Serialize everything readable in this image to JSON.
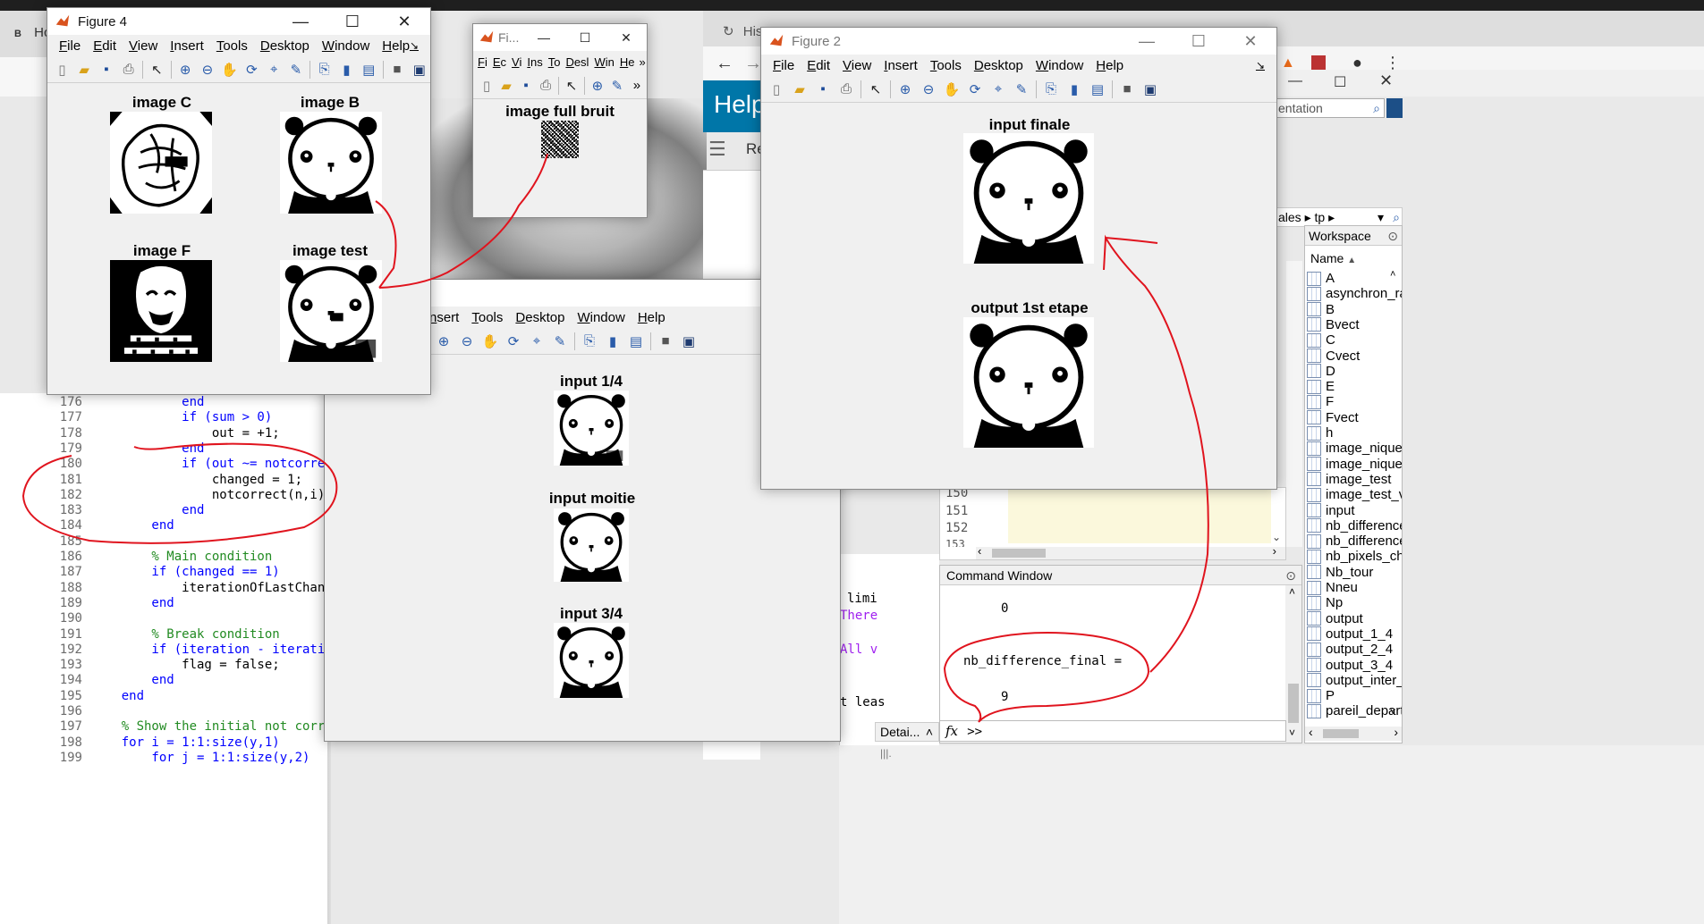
{
  "figure4": {
    "title": "Figure 4",
    "menu": [
      "File",
      "Edit",
      "View",
      "Insert",
      "Tools",
      "Desktop",
      "Window",
      "Help"
    ],
    "axes": [
      "image C",
      "image B",
      "image F",
      "image test"
    ]
  },
  "figure_small": {
    "title": "Fi...",
    "menu": [
      "Fi",
      "Ec",
      "Vi",
      "Ins",
      "To",
      "Desl",
      "Win",
      "He"
    ],
    "axes": [
      "image full bruit"
    ]
  },
  "figure_center": {
    "menu": [
      "nsert",
      "Tools",
      "Desktop",
      "Window",
      "Help"
    ],
    "axes": [
      "input 1/4",
      "input moitie",
      "input 3/4"
    ]
  },
  "figure2": {
    "title": "Figure 2",
    "menu": [
      "File",
      "Edit",
      "View",
      "Insert",
      "Tools",
      "Desktop",
      "Window",
      "Help"
    ],
    "axes": [
      "input finale",
      "output 1st etape"
    ]
  },
  "browser": {
    "tab_short": "Hc",
    "tab_hist": "Hist",
    "help_title": "Help",
    "help_search_frag": "Re",
    "doc_search_placeholder": "entation",
    "breadcrumb": [
      "ales",
      "tp"
    ]
  },
  "editor": {
    "lines": [
      {
        "n": "176",
        "text": "            end",
        "kind": "kw"
      },
      {
        "n": "177",
        "text": "            if (sum > 0)",
        "kind": "kw"
      },
      {
        "n": "178",
        "text": "                out = +1;",
        "kind": "tx"
      },
      {
        "n": "179",
        "text": "            end",
        "kind": "kw"
      },
      {
        "n": "180",
        "text": "            if (out ~= notcorrect(n, i))",
        "kind": "kw"
      },
      {
        "n": "181",
        "text": "                changed = 1;",
        "kind": "tx"
      },
      {
        "n": "182",
        "text": "                notcorrect(n,i) = out;",
        "kind": "tx"
      },
      {
        "n": "183",
        "text": "            end",
        "kind": "kw"
      },
      {
        "n": "184",
        "text": "        end",
        "kind": "kw"
      },
      {
        "n": "185",
        "text": "",
        "kind": "tx"
      },
      {
        "n": "186",
        "text": "        % Main condition",
        "kind": "cm"
      },
      {
        "n": "187",
        "text": "        if (changed == 1)",
        "kind": "kw"
      },
      {
        "n": "188",
        "text": "            iterationOfLastChange = iter",
        "kind": "tx"
      },
      {
        "n": "189",
        "text": "        end",
        "kind": "kw"
      },
      {
        "n": "190",
        "text": "",
        "kind": "tx"
      },
      {
        "n": "191",
        "text": "        % Break condition",
        "kind": "cm"
      },
      {
        "n": "192",
        "text": "        if (iteration - iterationOfLastC",
        "kind": "kw"
      },
      {
        "n": "193",
        "text": "            flag = false;",
        "kind": "tx"
      },
      {
        "n": "194",
        "text": "        end",
        "kind": "kw"
      },
      {
        "n": "195",
        "text": "    end",
        "kind": "kw"
      },
      {
        "n": "196",
        "text": "",
        "kind": "tx"
      },
      {
        "n": "197",
        "text": "    % Show the initial not correct input",
        "kind": "cm"
      },
      {
        "n": "198",
        "text": "    for i = 1:1:size(y,1)",
        "kind": "kw"
      },
      {
        "n": "199",
        "text": "        for j = 1:1:size(y,2)",
        "kind": "kw"
      }
    ],
    "right_lines": [
      "150",
      "151",
      "152",
      "153"
    ]
  },
  "command_window": {
    "title": "Command Window",
    "value_zero": "0",
    "var_line": "nb_difference_final =",
    "value_final": "9",
    "prompt": ">>",
    "fx": "fx",
    "partial_lines": [
      "limi",
      "There",
      "All v",
      "t leas"
    ]
  },
  "details_label": "Detai...",
  "workspace": {
    "title": "Workspace",
    "header": "Name",
    "items": [
      "A",
      "asynchron_ra",
      "B",
      "Bvect",
      "C",
      "Cvect",
      "D",
      "E",
      "F",
      "Fvect",
      "h",
      "image_nique",
      "image_nique",
      "image_test",
      "image_test_v",
      "input",
      "nb_difference",
      "nb_difference",
      "nb_pixels_cha",
      "Nb_tour",
      "Nneu",
      "Np",
      "output",
      "output_1_4",
      "output_2_4",
      "output_3_4",
      "output_inter_",
      "P",
      "pareil_depart"
    ]
  },
  "colors": {
    "annotation": "#e0141e",
    "help_bar": "#0076a8",
    "keyword": "#0000ff",
    "comment": "#228b22"
  }
}
